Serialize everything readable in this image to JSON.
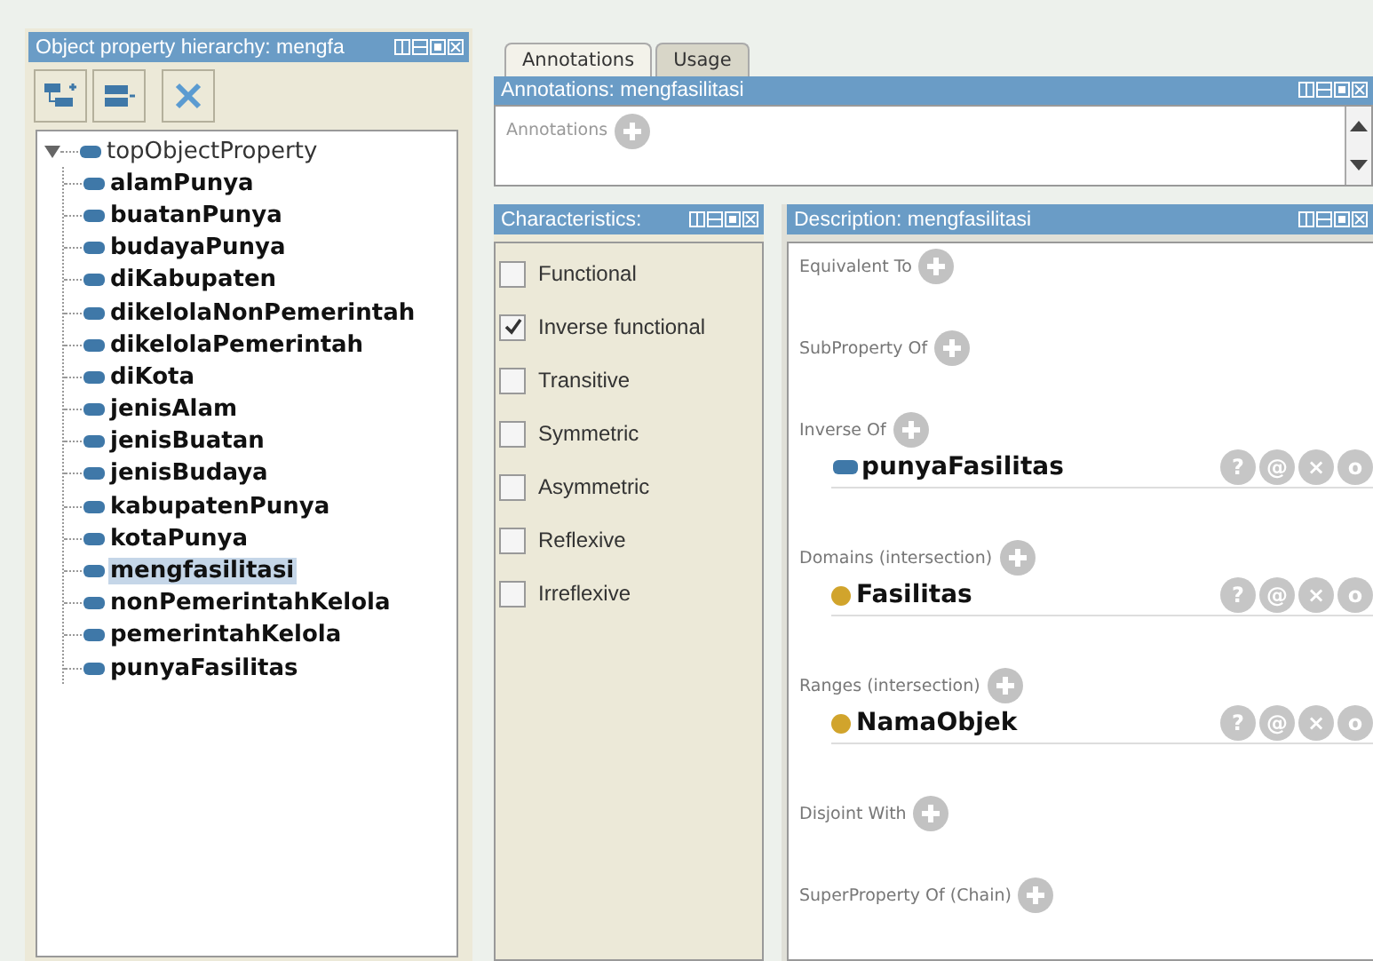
{
  "hierarchy": {
    "title": "Object property hierarchy: mengfa",
    "root": {
      "label": "topObjectProperty",
      "expanded": true,
      "children": [
        {
          "label": "alamPunya",
          "selected": false
        },
        {
          "label": "buatanPunya",
          "selected": false
        },
        {
          "label": "budayaPunya",
          "selected": false
        },
        {
          "label": "diKabupaten",
          "selected": false
        },
        {
          "label": "dikelolaNonPemerintah",
          "selected": false
        },
        {
          "label": "dikelolaPemerintah",
          "selected": false
        },
        {
          "label": "diKota",
          "selected": false
        },
        {
          "label": "jenisAlam",
          "selected": false
        },
        {
          "label": "jenisBuatan",
          "selected": false
        },
        {
          "label": "jenisBudaya",
          "selected": false
        },
        {
          "label": "kabupatenPunya",
          "selected": false
        },
        {
          "label": "kotaPunya",
          "selected": false
        },
        {
          "label": "mengfasilitasi",
          "selected": true
        },
        {
          "label": "nonPemerintahKelola",
          "selected": false
        },
        {
          "label": "pemerintahKelola",
          "selected": false
        },
        {
          "label": "punyaFasilitas",
          "selected": false
        }
      ]
    }
  },
  "tabs": [
    {
      "label": "Annotations",
      "selected": true
    },
    {
      "label": "Usage",
      "selected": false
    }
  ],
  "annotations": {
    "title": "Annotations: mengfasilitasi",
    "label": "Annotations"
  },
  "characteristics": {
    "title": "Characteristics:",
    "items": [
      {
        "label": "Functional",
        "checked": false
      },
      {
        "label": "Inverse functional",
        "checked": true
      },
      {
        "label": "Transitive",
        "checked": false
      },
      {
        "label": "Symmetric",
        "checked": false
      },
      {
        "label": "Asymmetric",
        "checked": false
      },
      {
        "label": "Reflexive",
        "checked": false
      },
      {
        "label": "Irreflexive",
        "checked": false
      }
    ]
  },
  "description": {
    "title": "Description: mengfasilitasi",
    "sections": [
      {
        "label": "Equivalent To"
      },
      {
        "label": "SubProperty Of"
      },
      {
        "label": "Inverse Of",
        "items": [
          {
            "kind": "property",
            "label": "punyaFasilitas",
            "actions": [
              "?",
              "@",
              "×",
              "o"
            ]
          }
        ]
      },
      {
        "label": "Domains (intersection)",
        "items": [
          {
            "kind": "class",
            "label": "Fasilitas",
            "actions": [
              "?",
              "@",
              "×",
              "o"
            ]
          }
        ]
      },
      {
        "label": "Ranges (intersection)",
        "items": [
          {
            "kind": "class",
            "label": "NamaObjek",
            "actions": [
              "?",
              "@",
              "×",
              "o"
            ]
          }
        ]
      },
      {
        "label": "Disjoint With"
      },
      {
        "label": "SuperProperty Of (Chain)"
      }
    ]
  }
}
